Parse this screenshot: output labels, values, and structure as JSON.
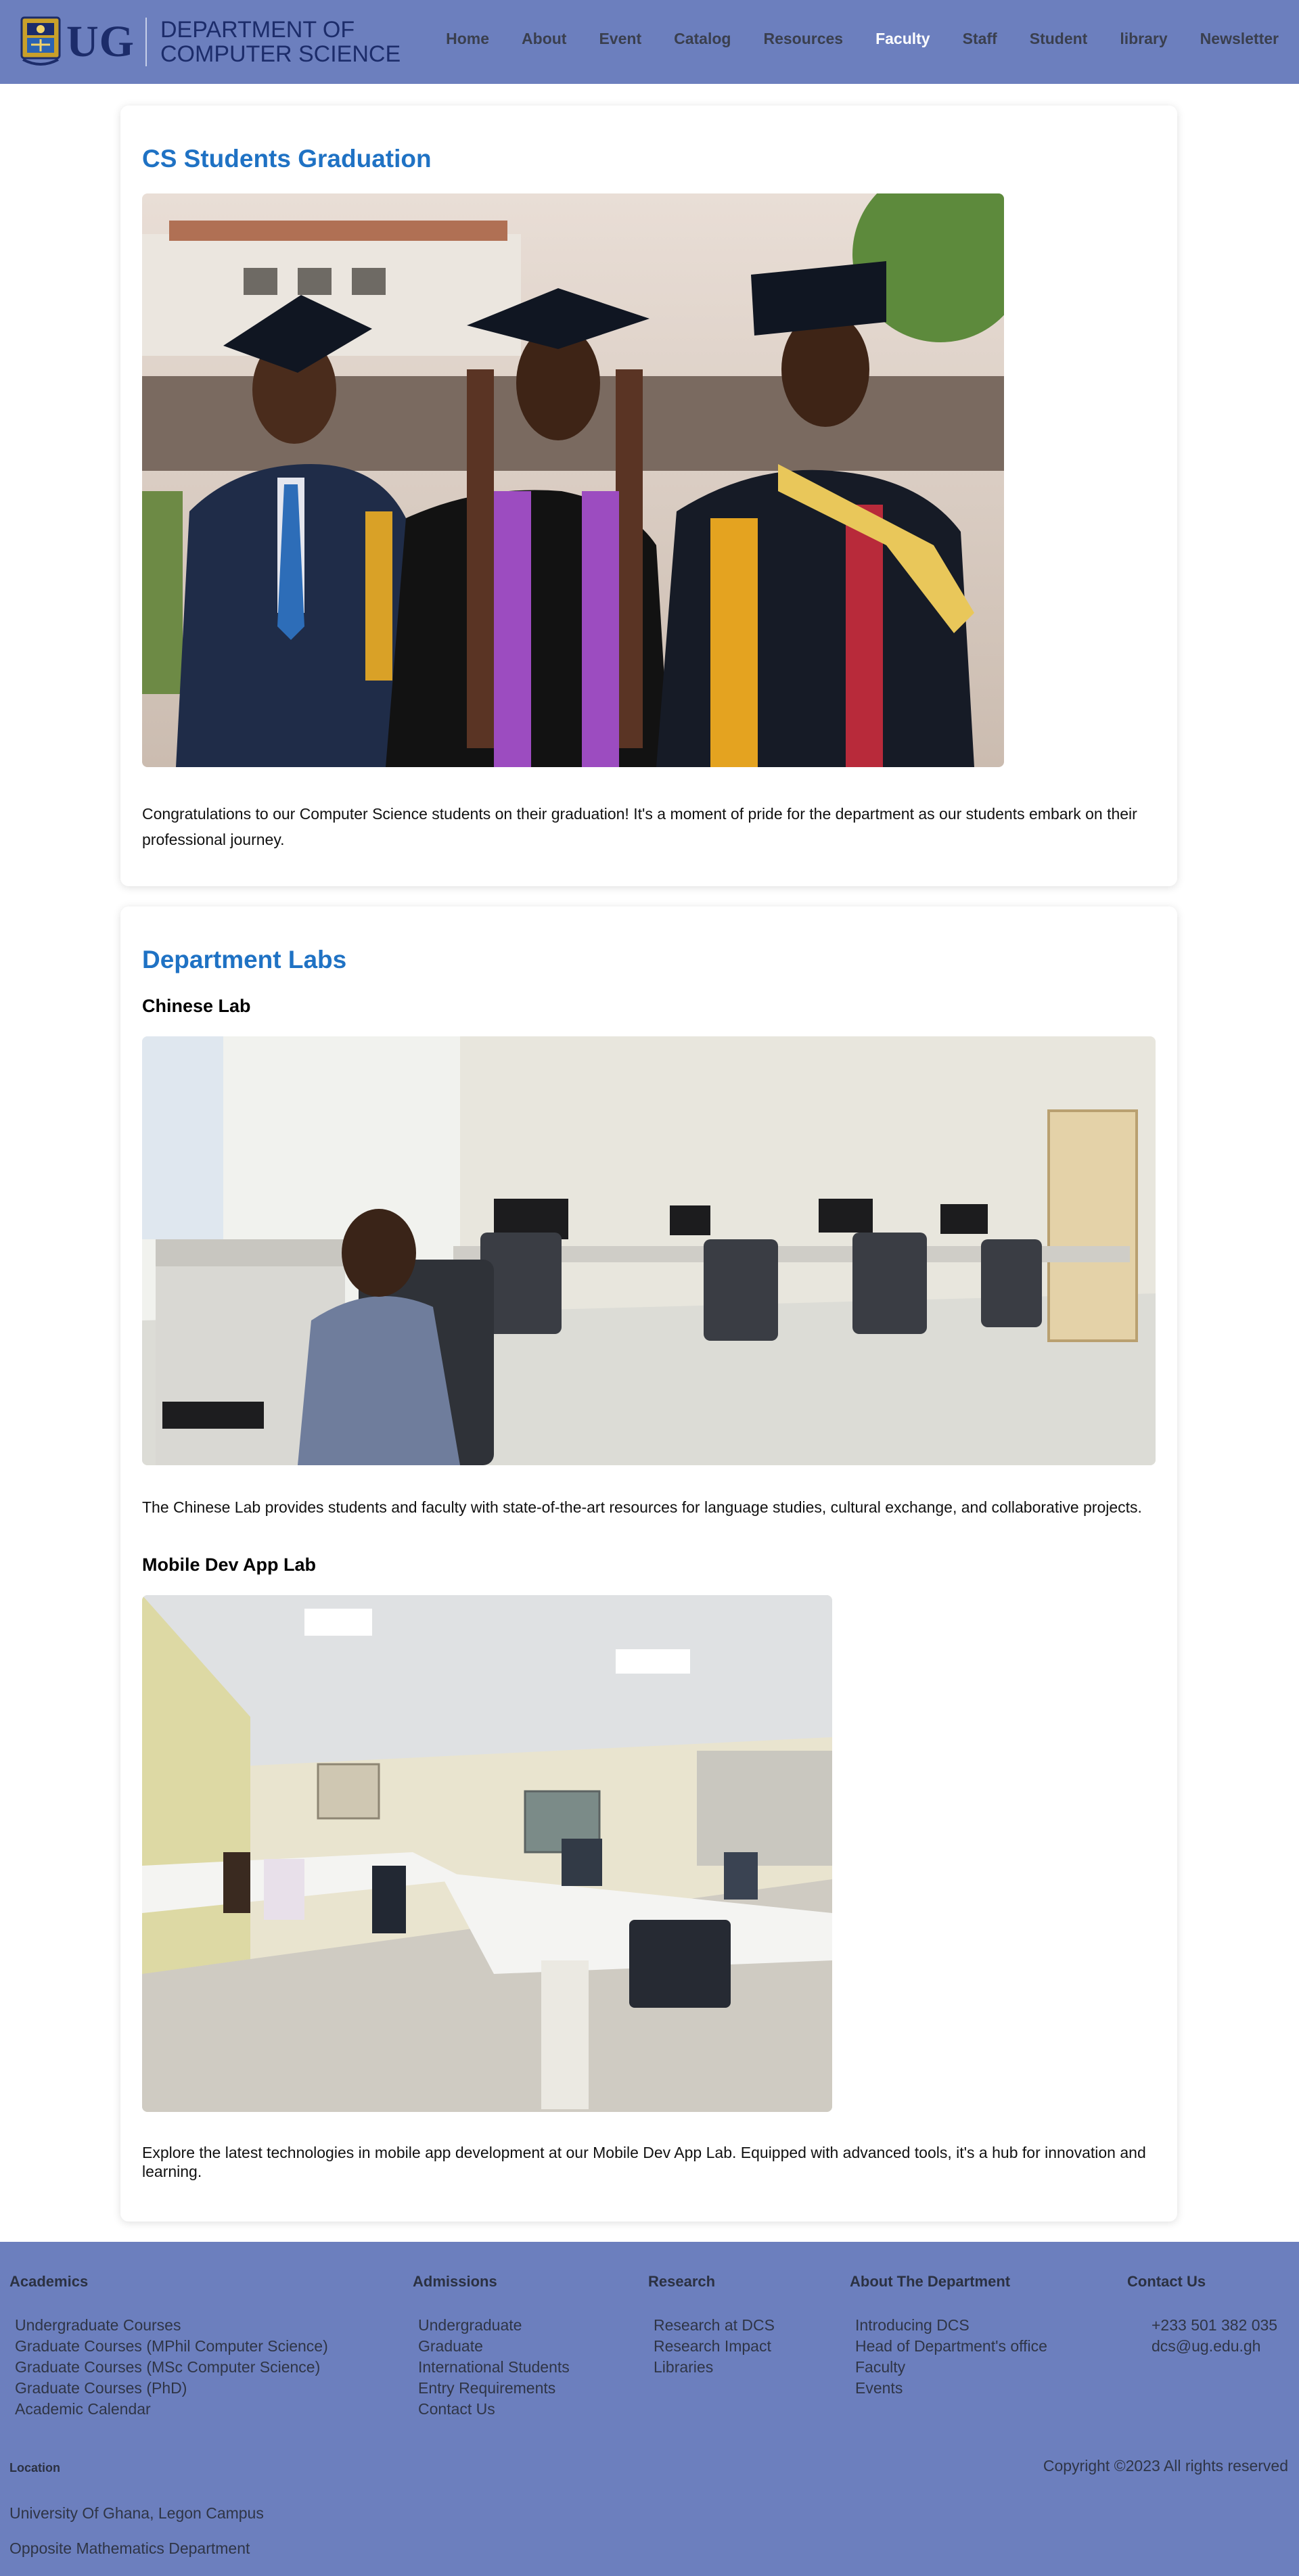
{
  "header": {
    "logo_text": "UG",
    "dept_line1": "DEPARTMENT OF",
    "dept_line2": "COMPUTER SCIENCE",
    "nav": [
      {
        "label": "Home",
        "active": false
      },
      {
        "label": "About",
        "active": false
      },
      {
        "label": "Event",
        "active": false
      },
      {
        "label": "Catalog",
        "active": false
      },
      {
        "label": "Resources",
        "active": false
      },
      {
        "label": "Faculty",
        "active": true
      },
      {
        "label": "Staff",
        "active": false
      },
      {
        "label": "Student",
        "active": false
      },
      {
        "label": "library",
        "active": false
      },
      {
        "label": "Newsletter",
        "active": false
      }
    ]
  },
  "graduation": {
    "title": "CS Students Graduation",
    "image": "graduation-photo",
    "text": "Congratulations to our Computer Science students on their graduation! It's a moment of pride for the department as our students embark on their professional journey."
  },
  "labs": {
    "title": "Department Labs",
    "items": [
      {
        "name": "Chinese Lab",
        "image": "chinese-lab-photo",
        "text": "The Chinese Lab provides students and faculty with state-of-the-art resources for language studies, cultural exchange, and collaborative projects."
      },
      {
        "name": "Mobile Dev App Lab",
        "image": "mobile-dev-lab-photo",
        "text": "Explore the latest technologies in mobile app development at our Mobile Dev App Lab. Equipped with advanced tools, it's a hub for innovation and learning."
      }
    ]
  },
  "footer": {
    "academics": {
      "title": "Academics",
      "links": [
        "Undergraduate Courses",
        "Graduate Courses (MPhil Computer Science)",
        "Graduate Courses (MSc Computer Science)",
        "Graduate Courses (PhD)",
        "Academic Calendar"
      ]
    },
    "admissions": {
      "title": "Admissions",
      "links": [
        "Undergraduate",
        "Graduate",
        "International Students",
        "Entry Requirements",
        "Contact Us"
      ]
    },
    "research": {
      "title": "Research",
      "links": [
        "Research at DCS",
        "Research Impact",
        "Libraries"
      ]
    },
    "about": {
      "title": "About The Department",
      "links": [
        "Introducing DCS",
        "Head of Department's office",
        "Faculty",
        "Events"
      ]
    },
    "contact": {
      "title": "Contact Us",
      "phone": "+233 501 382 035",
      "email": "dcs@ug.edu.gh"
    },
    "location": {
      "title": "Location",
      "line1": "University Of Ghana, Legon Campus",
      "line2": "Opposite Mathematics Department"
    },
    "copyright": "Copyright ©2023 All rights reserved"
  },
  "colors": {
    "header_bg": "#6c7fbe",
    "heading_blue": "#1f72c4",
    "logo_navy": "#1c2c6a"
  }
}
